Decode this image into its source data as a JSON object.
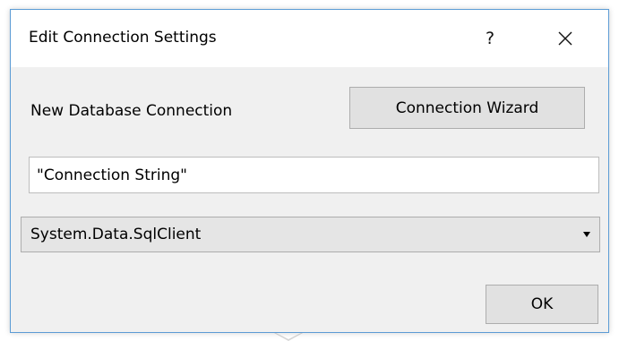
{
  "window": {
    "title": "Edit Connection Settings",
    "help_label": "?",
    "close_icon": "close-icon"
  },
  "connection": {
    "label": "New Database Connection",
    "wizard_button_label": "Connection Wizard",
    "connection_string_value": "\"Connection String\"",
    "provider_selected": "System.Data.SqlClient"
  },
  "footer": {
    "ok_label": "OK"
  },
  "colors": {
    "dialog_border": "#5b9bd5",
    "dialog_background": "#f0f0f0",
    "button_background": "#e1e1e1",
    "button_border": "#adadad"
  }
}
